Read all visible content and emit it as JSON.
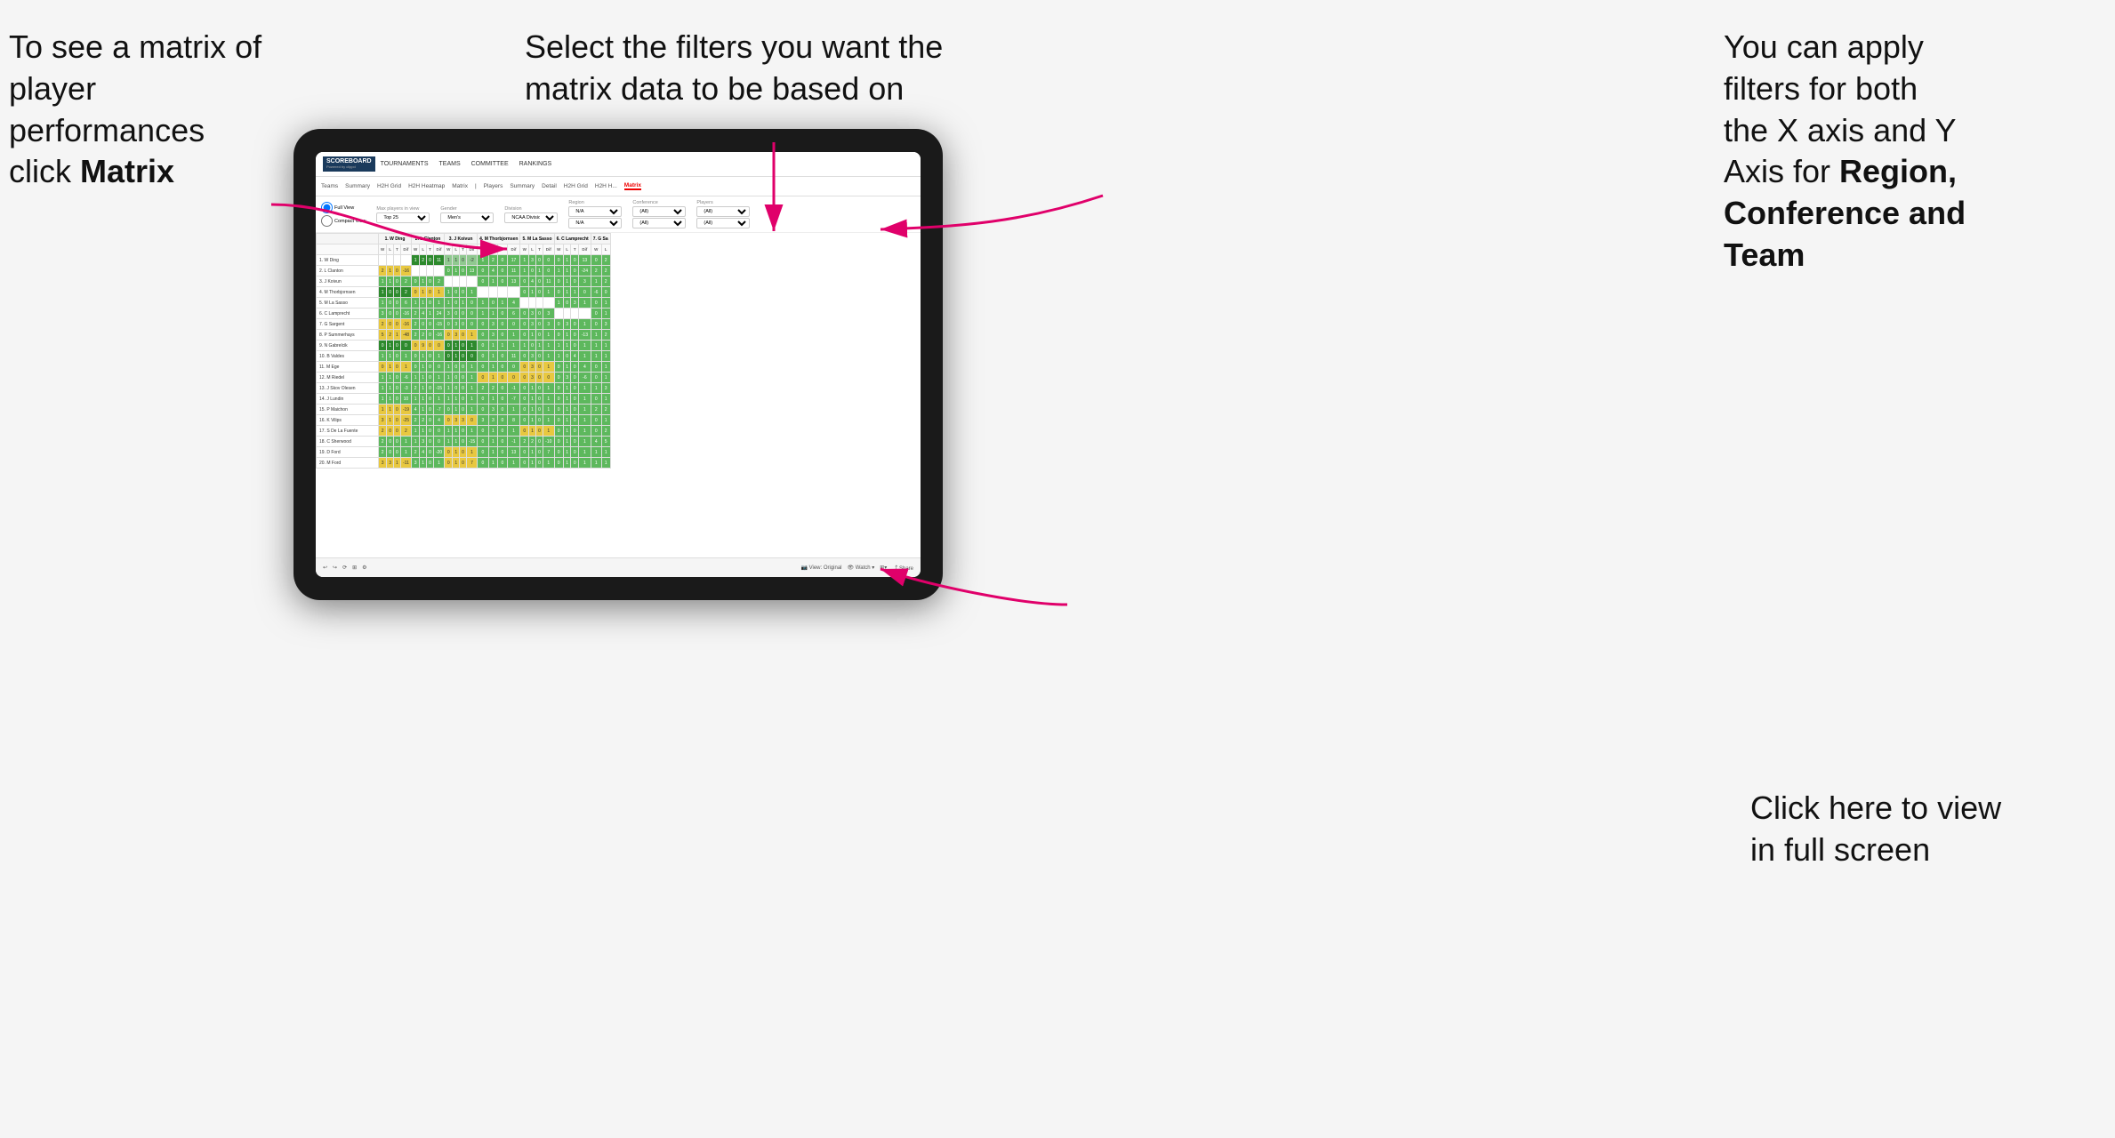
{
  "annotations": {
    "topleft": {
      "line1": "To see a matrix of",
      "line2": "player performances",
      "line3_normal": "click ",
      "line3_bold": "Matrix"
    },
    "topmid": {
      "text": "Select the filters you want the matrix data to be based on"
    },
    "topright": {
      "line1": "You  can apply",
      "line2": "filters for both",
      "line3": "the X axis and Y",
      "line4_normal": "Axis for ",
      "line4_bold": "Region,",
      "line5_bold": "Conference and",
      "line6_bold": "Team"
    },
    "bottomright": {
      "line1": "Click here to view",
      "line2": "in full screen"
    }
  },
  "app": {
    "logo_line1": "SCOREBOARD",
    "logo_line2": "Powered by clippd",
    "nav": [
      "TOURNAMENTS",
      "TEAMS",
      "COMMITTEE",
      "RANKINGS"
    ],
    "subnav_items": [
      "Teams",
      "Summary",
      "H2H Grid",
      "H2H Heatmap",
      "Matrix",
      "Players",
      "Summary",
      "Detail",
      "H2H Grid",
      "H2H H...",
      "Matrix"
    ],
    "active_subnav": "Matrix"
  },
  "filters": {
    "view_options": [
      "Full View",
      "Compact View"
    ],
    "max_players": "Top 25",
    "gender": "Men's",
    "division": "NCAA Division I",
    "region_label": "Region",
    "region_value1": "N/A",
    "region_value2": "N/A",
    "conference_label": "Conference",
    "conference_value1": "(All)",
    "conference_value2": "(All)",
    "players_label": "Players",
    "players_value1": "(All)",
    "players_value2": "(All)"
  },
  "matrix": {
    "col_headers": [
      "1. W Ding",
      "2. L Clanton",
      "3. J Koivun",
      "4. M Thorbjornsen",
      "5. M La Sasso",
      "6. C Lamprecht",
      "7. G Sa"
    ],
    "sub_headers": [
      "W",
      "L",
      "T",
      "Dif"
    ],
    "rows": [
      {
        "name": "1. W Ding",
        "cells": []
      },
      {
        "name": "2. L Clanton"
      },
      {
        "name": "3. J Koivun"
      },
      {
        "name": "4. M Thorbjornsen"
      },
      {
        "name": "5. M La Sasso"
      },
      {
        "name": "6. C Lamprecht"
      },
      {
        "name": "7. G Sargent"
      },
      {
        "name": "8. P Summerhays"
      },
      {
        "name": "9. N Gabrelcik"
      },
      {
        "name": "10. B Valdes"
      },
      {
        "name": "11. M Ege"
      },
      {
        "name": "12. M Riedel"
      },
      {
        "name": "13. J Skov Olesen"
      },
      {
        "name": "14. J Lundin"
      },
      {
        "name": "15. P Maichon"
      },
      {
        "name": "16. K Vilips"
      },
      {
        "name": "17. S De La Fuente"
      },
      {
        "name": "18. C Sherwood"
      },
      {
        "name": "19. D Ford"
      },
      {
        "name": "20. M Ford"
      }
    ]
  },
  "toolbar": {
    "view_label": "View: Original",
    "watch_label": "Watch",
    "share_label": "Share"
  }
}
